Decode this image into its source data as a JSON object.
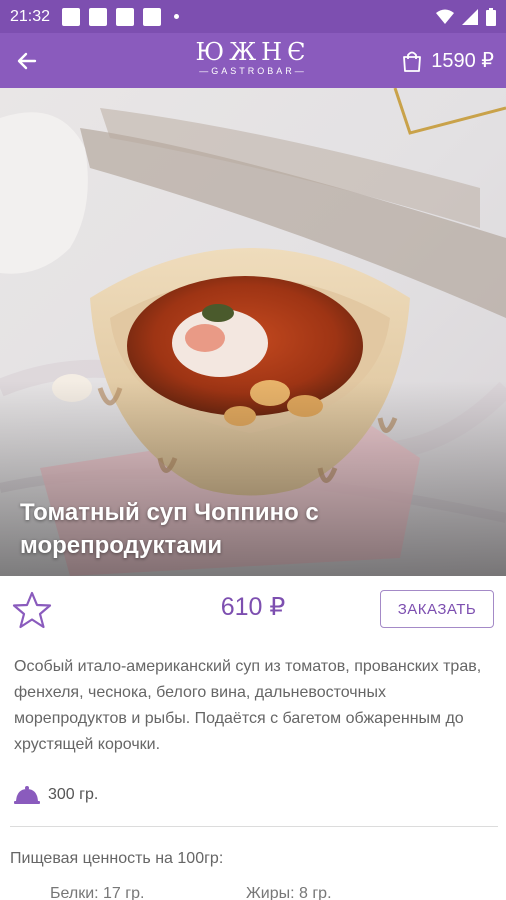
{
  "status_bar": {
    "time": "21:32"
  },
  "header": {
    "logo_text": "ЮЖНЄ",
    "logo_subtitle": "—GASTROBAR—",
    "cart_total": "1590 ₽"
  },
  "dish": {
    "title": "Томатный суп Чоппино с морепродуктами",
    "price": "610 ₽",
    "order_label": "ЗАКАЗАТЬ",
    "description": "Особый итало-американский суп из томатов, прованских трав, фенхеля, чеснока, белого вина, дальневосточных морепродуктов и рыбы. Подаётся с багетом обжаренным до хрустящей корочки.",
    "weight": "300 гр."
  },
  "nutrition": {
    "title": "Пищевая ценность на 100гр:",
    "proteins": "Белки: 17 гр.",
    "fats": "Жиры: 8 гр."
  },
  "colors": {
    "status_bar": "#7d4fb0",
    "toolbar": "#8a5bbd",
    "accent": "#7d4fb0"
  },
  "icons": {
    "back": "arrow-left-icon",
    "cart": "shopping-bag-icon",
    "favorite": "star-outline-icon",
    "weight": "dish-cloche-icon"
  }
}
